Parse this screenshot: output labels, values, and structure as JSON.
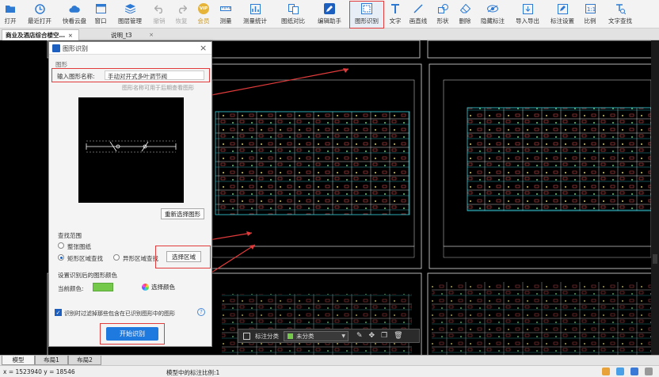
{
  "toolbar": {
    "items": [
      {
        "label": "打开",
        "icon": "folder-open-icon"
      },
      {
        "label": "最近打开",
        "icon": "clock-icon"
      },
      {
        "label": "快看云盘",
        "icon": "cloud-icon"
      },
      {
        "label": "窗口",
        "icon": "window-icon"
      },
      {
        "label": "图层管理",
        "icon": "layers-icon"
      },
      {
        "label": "撤销",
        "icon": "undo-icon"
      },
      {
        "label": "恢复",
        "icon": "redo-icon"
      },
      {
        "label": "会员",
        "icon": "vip-icon"
      },
      {
        "label": "测量",
        "icon": "ruler-icon"
      },
      {
        "label": "测量统计",
        "icon": "measure-stats-icon"
      },
      {
        "label": "图纸对比",
        "icon": "compare-icon"
      },
      {
        "label": "编辑助手",
        "icon": "edit-assistant-icon"
      },
      {
        "label": "图形识别",
        "icon": "shape-recognition-icon"
      },
      {
        "label": "文字",
        "icon": "text-icon"
      },
      {
        "label": "画直线",
        "icon": "line-icon"
      },
      {
        "label": "形状",
        "icon": "shape-icon"
      },
      {
        "label": "删除",
        "icon": "eraser-icon"
      },
      {
        "label": "隐藏标注",
        "icon": "hide-annotation-icon"
      },
      {
        "label": "导入导出",
        "icon": "import-export-icon"
      },
      {
        "label": "标注设置",
        "icon": "annotation-settings-icon"
      },
      {
        "label": "比例",
        "icon": "scale-icon"
      },
      {
        "label": "文字查找",
        "icon": "text-search-icon"
      }
    ],
    "vip_badge": "VIP"
  },
  "tabs": [
    {
      "label": "商业及酒店综合楼空…",
      "close": "×"
    },
    {
      "label": "说明_t3",
      "close": "×"
    }
  ],
  "dialog": {
    "title": "图形识别",
    "close": "×",
    "section_shape": "图形",
    "name_label": "输入图形名称:",
    "name_value": "手动对开式多叶调节阀",
    "name_hint": "图形名称可用于后期查看图形",
    "reselect_button": "重新选择图形",
    "scope_title": "查找范围",
    "scope_options": [
      "整张图纸",
      "矩形区域查找",
      "异形区域查找"
    ],
    "select_area_button": "选择区域",
    "color_section": "设置识别后的图形颜色",
    "current_color_label": "当前颜色:",
    "current_color": "#74c94a",
    "select_color_button": "选择颜色",
    "filter_checkbox_label": "识别时过滤掉那些包含在已识别图形中的图形",
    "help": "?",
    "start_button": "开始识别"
  },
  "floatbar": {
    "annotation_category_label": "标注分类",
    "category_value": "未分类"
  },
  "bottom_tabs": [
    "模型",
    "布局1",
    "布局2"
  ],
  "status": {
    "coords": "x = 1523940  y = 18546",
    "scale": "模型中的标注比例:1"
  },
  "colors": {
    "accent": "#1d5fbf",
    "highlight": "#e23b3b",
    "cad_cyan": "#38d6e0"
  }
}
